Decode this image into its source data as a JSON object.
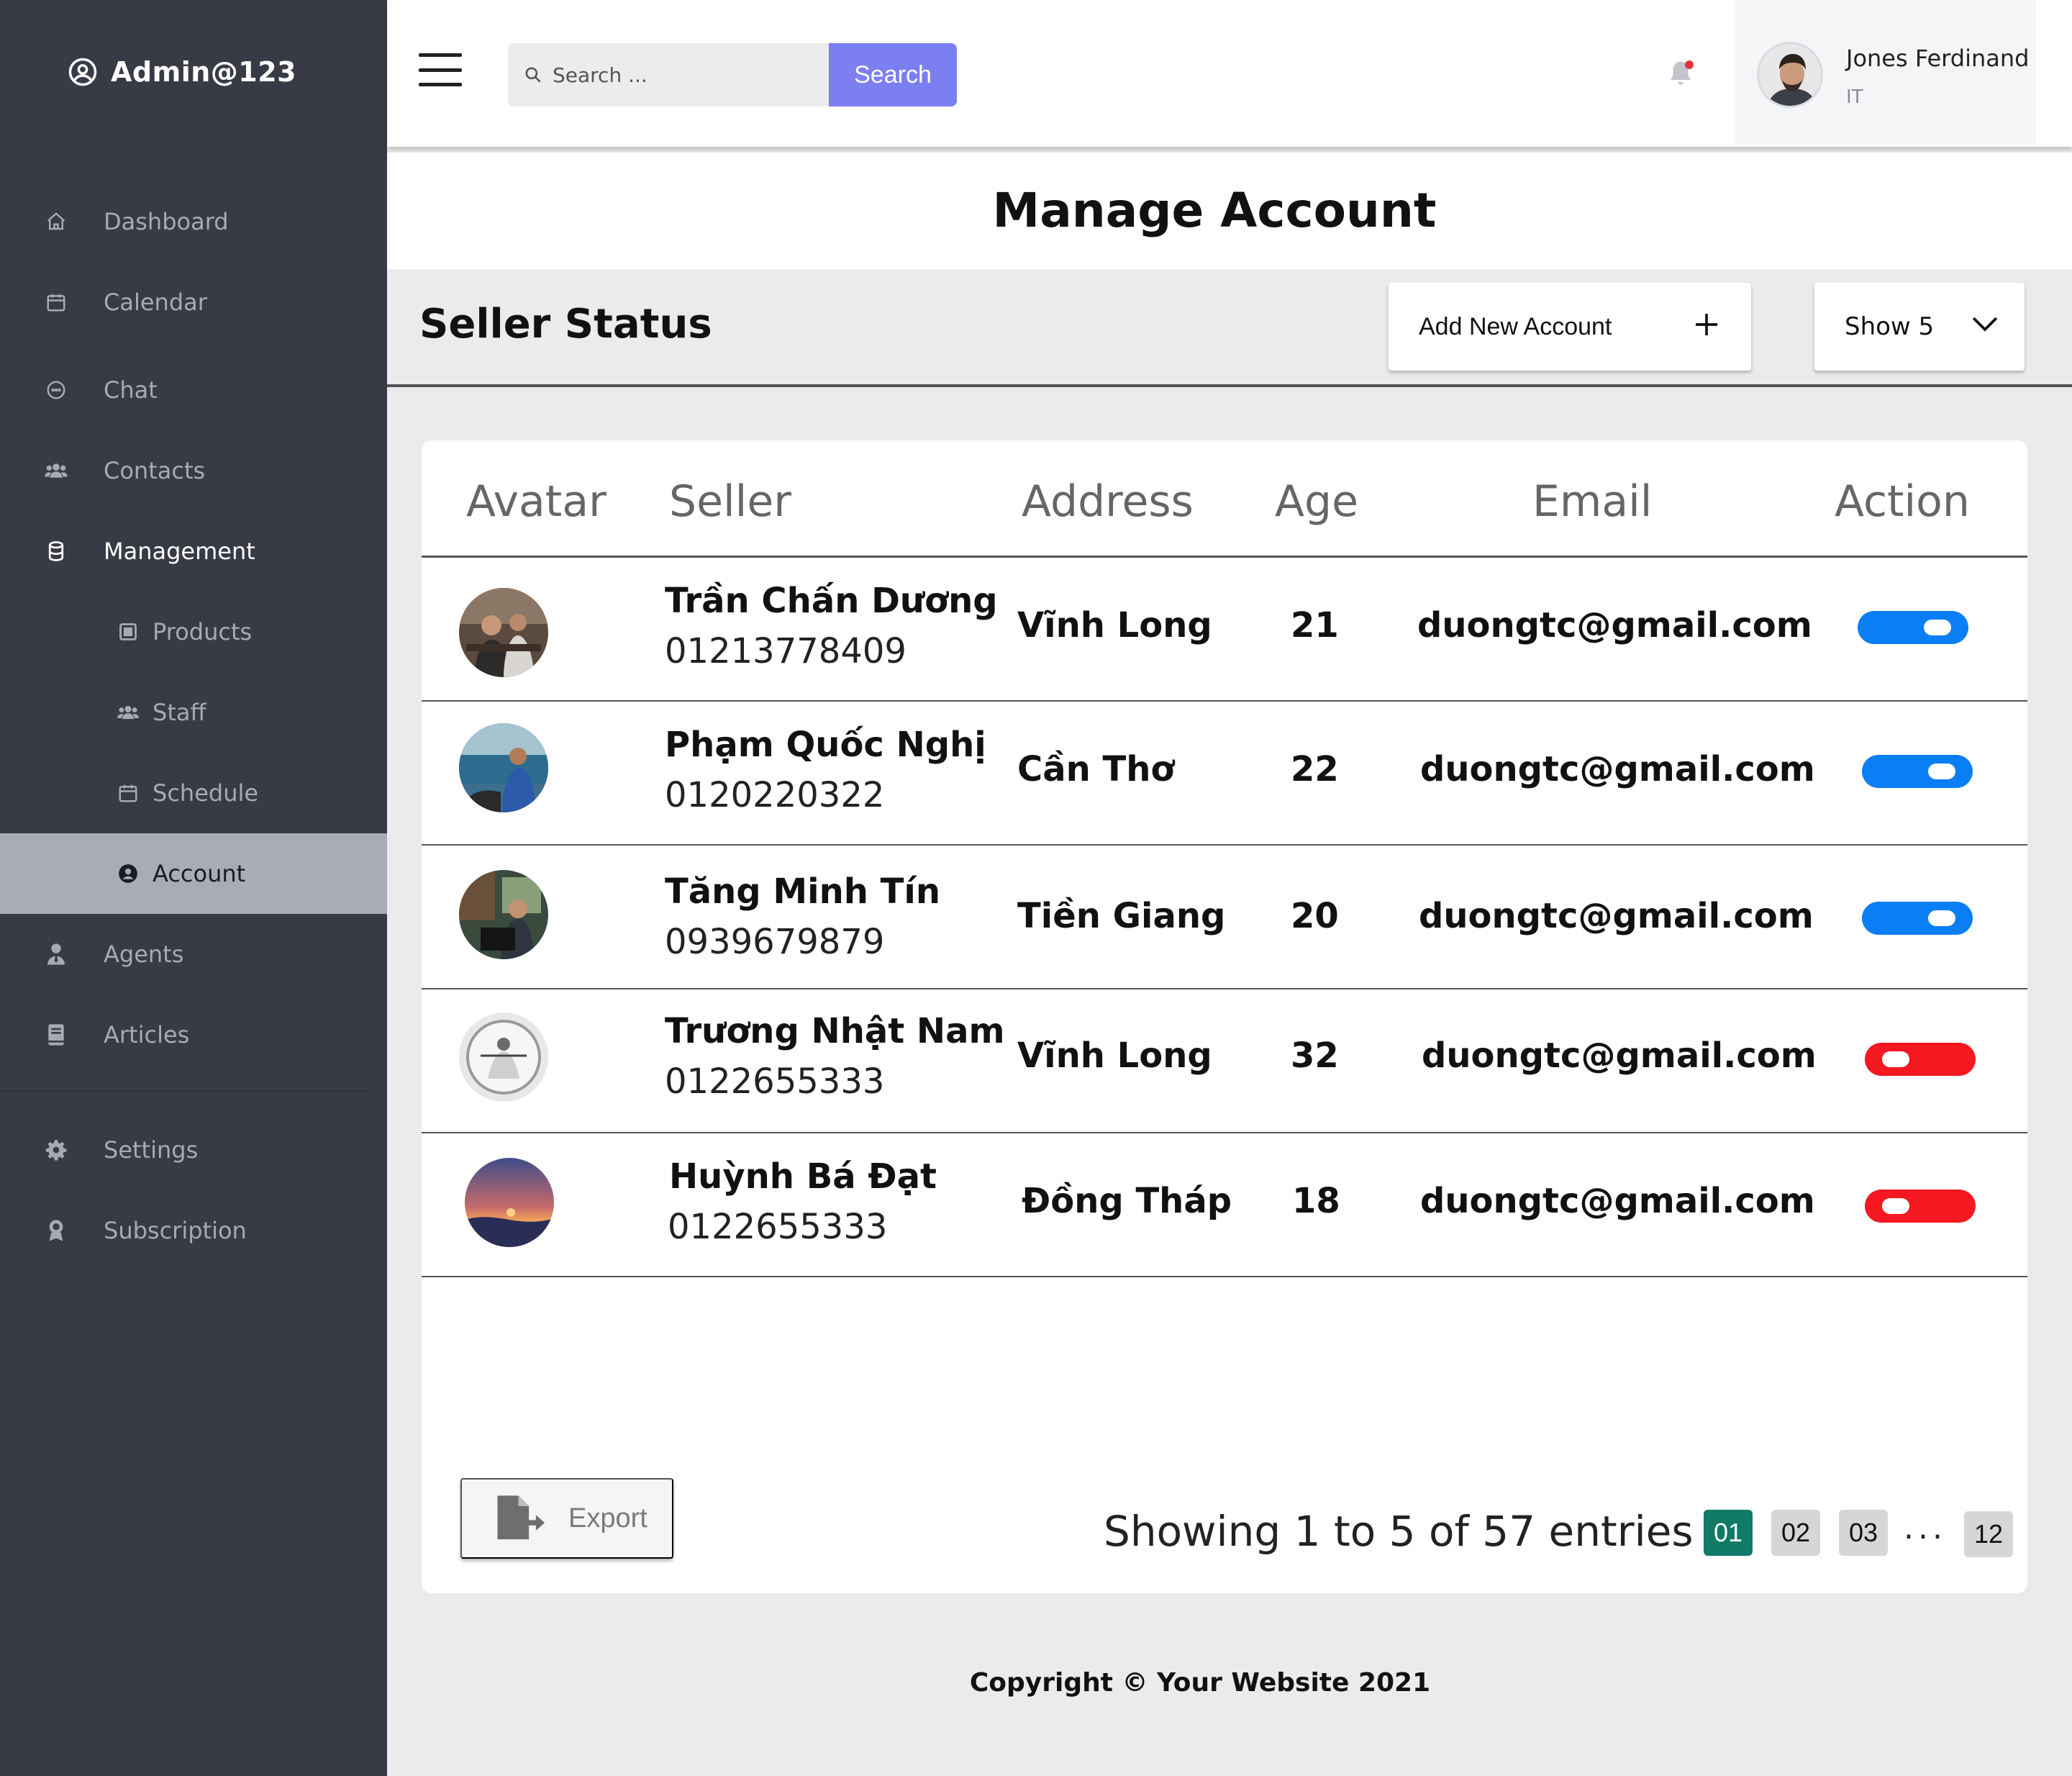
{
  "sidebar": {
    "brand": "Admin@123",
    "items": [
      {
        "label": "Dashboard",
        "icon": "home-icon"
      },
      {
        "label": "Calendar",
        "icon": "calendar-icon"
      },
      {
        "label": "Chat",
        "icon": "chat-icon"
      },
      {
        "label": "Contacts",
        "icon": "users-icon"
      },
      {
        "label": "Management",
        "icon": "database-icon"
      },
      {
        "label": "Products",
        "icon": "square-icon"
      },
      {
        "label": "Staff",
        "icon": "users-icon"
      },
      {
        "label": "Schedule",
        "icon": "calendar-icon"
      },
      {
        "label": "Account",
        "icon": "user-circle-icon"
      },
      {
        "label": "Agents",
        "icon": "agent-icon"
      },
      {
        "label": "Articles",
        "icon": "book-icon"
      },
      {
        "label": "Settings",
        "icon": "gear-icon"
      },
      {
        "label": "Subscription",
        "icon": "badge-icon"
      }
    ],
    "active_item": "Account"
  },
  "topbar": {
    "search_placeholder": "Search ...",
    "search_button": "Search",
    "user_name": "Jones Ferdinand",
    "user_role": "IT"
  },
  "page": {
    "title": "Manage Account",
    "section_title": "Seller Status",
    "add_button": "Add New Account",
    "show_select": "Show 5"
  },
  "table": {
    "headers": [
      "Avatar",
      "Seller",
      "Address",
      "Age",
      "Email",
      "Action"
    ],
    "rows": [
      {
        "name": "Trần Chấn Dương",
        "phone": "01213778409",
        "address": "Vĩnh Long",
        "age": "21",
        "email": "duongtc@gmail.com",
        "enabled": true
      },
      {
        "name": "Phạm Quốc Nghị",
        "phone": "0120220322",
        "address": "Cần Thơ",
        "age": "22",
        "email": "duongtc@gmail.com",
        "enabled": true
      },
      {
        "name": "Tăng Minh Tín",
        "phone": "0939679879",
        "address": "Tiền Giang",
        "age": "20",
        "email": "duongtc@gmail.com",
        "enabled": true
      },
      {
        "name": "Trương Nhật Nam",
        "phone": "0122655333",
        "address": "Vĩnh Long",
        "age": "32",
        "email": "duongtc@gmail.com",
        "enabled": false
      },
      {
        "name": "Huỳnh Bá Đạt",
        "phone": "0122655333",
        "address": "Đồng Tháp",
        "age": "18",
        "email": "duongtc@gmail.com",
        "enabled": false
      }
    ]
  },
  "footer_controls": {
    "export_label": "Export",
    "entries_text": "Showing 1 to 5 of 57 entries",
    "pages": [
      "01",
      "02",
      "03",
      "12"
    ],
    "current_page": "01",
    "ellipsis": "..."
  },
  "copyright": "Copyright © Your Website 2021",
  "colors": {
    "sidebar_bg": "#383a45",
    "active_item_bg": "#a9abb6",
    "search_button": "#7b7ff0",
    "toggle_on": "#0a7ef4",
    "toggle_off": "#f41820",
    "current_page": "#0f7a66"
  }
}
